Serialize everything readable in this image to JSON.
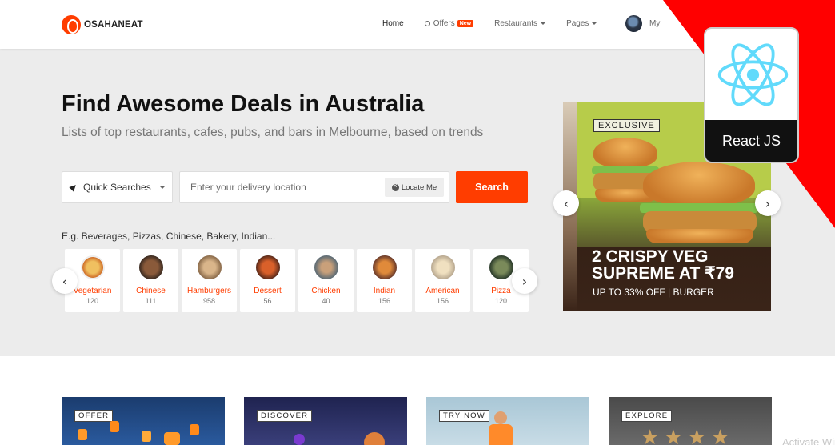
{
  "header": {
    "logo_text": "OSAHANEAT",
    "nav": {
      "home": "Home",
      "offers": "Offers",
      "offers_badge": "New",
      "restaurants": "Restaurants",
      "pages": "Pages",
      "account": "My"
    }
  },
  "hero": {
    "title_bold": "Find Awesome Deals",
    "title_rest": " in Australia",
    "subtitle": "Lists of top restaurants, cafes, pubs, and bars in Melbourne, based on trends",
    "quick_searches": "Quick Searches",
    "location_placeholder": "Enter your delivery location",
    "locate_me": "Locate Me",
    "search_button": "Search",
    "examples": "E.g. Beverages, Pizzas, Chinese, Bakery, Indian..."
  },
  "categories": [
    {
      "name": "Vegetarian",
      "count": "120",
      "color": "#e8a23a"
    },
    {
      "name": "Chinese",
      "count": "111",
      "color": "#6a4a3a"
    },
    {
      "name": "Hamburgers",
      "count": "958",
      "color": "#c9a27a"
    },
    {
      "name": "Dessert",
      "count": "56",
      "color": "#b3452a"
    },
    {
      "name": "Chicken",
      "count": "40",
      "color": "#7a8a94"
    },
    {
      "name": "Indian",
      "count": "156",
      "color": "#d0702a"
    },
    {
      "name": "American",
      "count": "156",
      "color": "#d9c9b0"
    },
    {
      "name": "Pizza",
      "count": "120",
      "color": "#4a5a4a"
    }
  ],
  "banner": {
    "label": "EXCLUSIVE",
    "headline_line1": "2 CRISPY VEG",
    "headline_line2": "SUPREME AT ₹79",
    "tagline": "UP TO 33% OFF | BURGER"
  },
  "react_badge": {
    "label": "React JS"
  },
  "promos": [
    {
      "tag": "OFFER",
      "color": "#1b3c6e"
    },
    {
      "tag": "DISCOVER",
      "color": "#2a2f5a"
    },
    {
      "tag": "TRY NOW",
      "color": "#a9c7d6"
    },
    {
      "tag": "EXPLORE",
      "color": "#5a5a5a"
    }
  ],
  "watermark": "Activate Windows",
  "colors": {
    "accent": "#ff3d00",
    "hero_bg": "#ececec",
    "ribbon": "#ff0000",
    "react_blue": "#61dafb"
  }
}
